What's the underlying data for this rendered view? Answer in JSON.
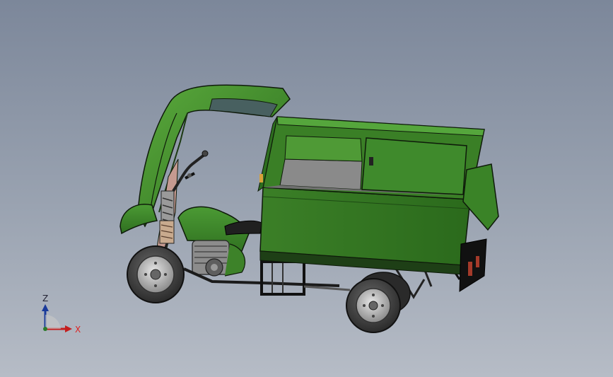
{
  "viewport": {
    "title": "",
    "background_top": "#7c879a",
    "background_bottom": "#b6bcc6"
  },
  "model": {
    "body_color": "#3f8a2c",
    "body_dark": "#2c6a1e",
    "edge_color": "#0e1a0a"
  },
  "triad": {
    "z_label": "Z",
    "x_label": "X",
    "z_color": "#1a3a9a",
    "x_color": "#c41e1e"
  }
}
